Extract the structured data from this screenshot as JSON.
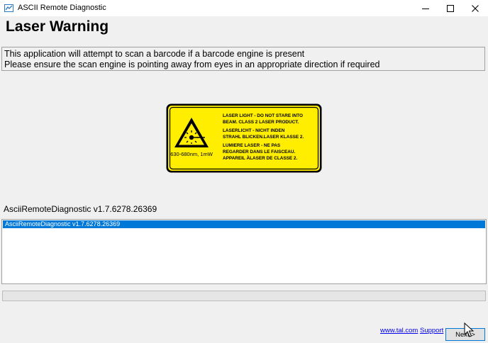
{
  "window": {
    "title": "ASCII Remote Diagnostic",
    "icon": "app-icon",
    "controls": [
      "minimize-icon",
      "maximize-icon",
      "close-icon"
    ]
  },
  "header": {
    "title": "Laser Warning"
  },
  "info": {
    "line1": "This application will attempt to scan a barcode if a barcode engine is present",
    "line2": "Please ensure the scan engine is pointing away from eyes in an appropriate direction if required"
  },
  "laser_label": {
    "wavelength": "630-680nm, 1mW",
    "text_lines": [
      "LASER LIGHT - DO NOT STARE INTO",
      "BEAM. CLASS 2 LASER PRODUCT.",
      "LASERLICHT - NICHT INDEN",
      "STRAHL BLICKEN.LASER KLASSE 2.",
      "LUMIERE LASER - NE PAS",
      "REGARDER DANS LE FAISCEAU.",
      "APPAREIL ÀLASER DE CLASSE 2."
    ],
    "colors": {
      "background": "#ffee00",
      "border": "#000000"
    }
  },
  "version_label": "AsciiRemoteDiagnostic v1.7.6278.26369",
  "list": {
    "items": [
      {
        "text": "AsciiRemoteDiagnostic v1.7.6278.26369",
        "selected": true
      }
    ]
  },
  "progress": {
    "value": 0
  },
  "footer": {
    "link_website": "www.tal.com",
    "link_support": "Support",
    "next_label": "Next >"
  },
  "colors": {
    "accent": "#0078d7",
    "link": "#0000ee"
  }
}
